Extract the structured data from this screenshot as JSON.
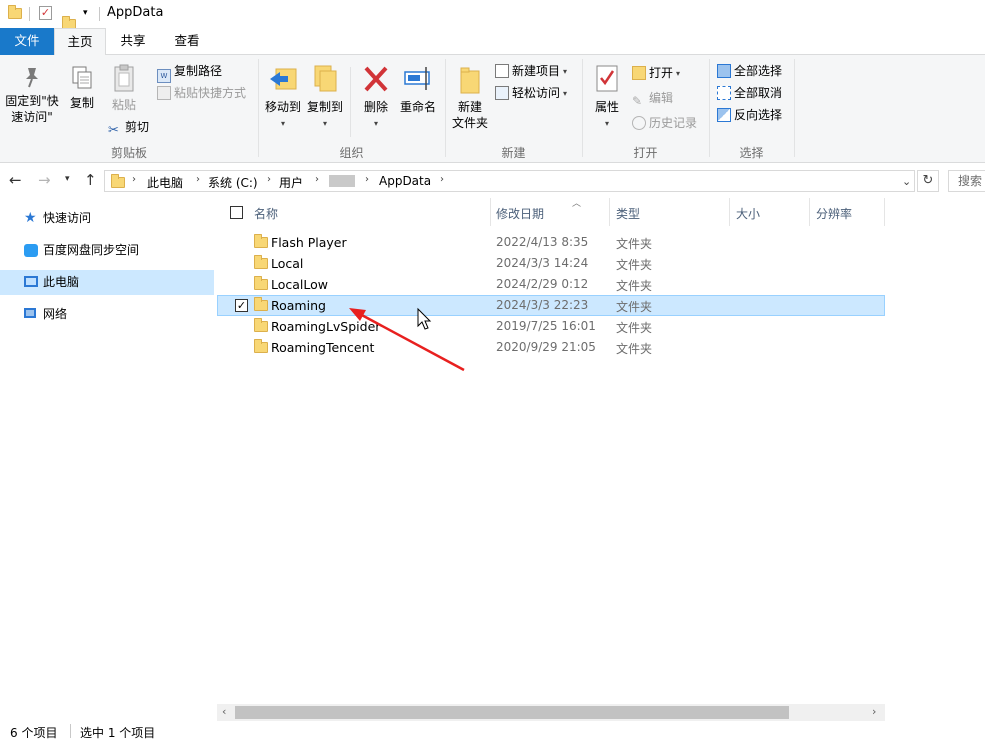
{
  "window": {
    "title": "AppData"
  },
  "ribbon_tabs": [
    "文件",
    "主页",
    "共享",
    "查看"
  ],
  "ribbon": {
    "clipboard": {
      "pin_label_1": "固定到\"快",
      "pin_label_2": "速访问\"",
      "copy": "复制",
      "paste": "粘贴",
      "copy_path": "复制路径",
      "paste_shortcut": "粘贴快捷方式",
      "cut": "剪切",
      "group": "剪贴板"
    },
    "organize": {
      "move_to": "移动到",
      "copy_to": "复制到",
      "delete": "删除",
      "rename": "重命名",
      "group": "组织"
    },
    "new": {
      "new_folder_1": "新建",
      "new_folder_2": "文件夹",
      "new_item": "新建项目",
      "easy_access": "轻松访问",
      "group": "新建"
    },
    "open": {
      "properties": "属性",
      "open": "打开",
      "edit": "编辑",
      "history": "历史记录",
      "group": "打开"
    },
    "select": {
      "select_all": "全部选择",
      "select_none": "全部取消",
      "invert": "反向选择",
      "group": "选择"
    }
  },
  "address": {
    "crumbs": [
      "此电脑",
      "系统 (C:)",
      "用户",
      "AppData"
    ],
    "search_placeholder": "搜索"
  },
  "nav": [
    {
      "label": "快速访问",
      "icon": "star-icon"
    },
    {
      "label": "百度网盘同步空间",
      "icon": "baidu-cloud-icon"
    },
    {
      "label": "此电脑",
      "icon": "computer-icon",
      "selected": true
    },
    {
      "label": "网络",
      "icon": "network-icon"
    }
  ],
  "columns": {
    "name": "名称",
    "date": "修改日期",
    "type": "类型",
    "size": "大小",
    "ratio": "分辨率"
  },
  "files": [
    {
      "name": "Flash Player",
      "date": "2022/4/13 8:35",
      "type": "文件夹"
    },
    {
      "name": "Local",
      "date": "2024/3/3 14:24",
      "type": "文件夹"
    },
    {
      "name": "LocalLow",
      "date": "2024/2/29 0:12",
      "type": "文件夹"
    },
    {
      "name": "Roaming",
      "date": "2024/3/3 22:23",
      "type": "文件夹",
      "selected": true
    },
    {
      "name": "RoamingLvSpider",
      "date": "2019/7/25 16:01",
      "type": "文件夹"
    },
    {
      "name": "RoamingTencent",
      "date": "2020/9/29 21:05",
      "type": "文件夹"
    }
  ],
  "status": {
    "count": "6 个项目",
    "selected": "选中 1 个项目"
  },
  "colors": {
    "accent": "#1979ca",
    "selection": "#cce8ff",
    "arrow": "#e8201f"
  }
}
